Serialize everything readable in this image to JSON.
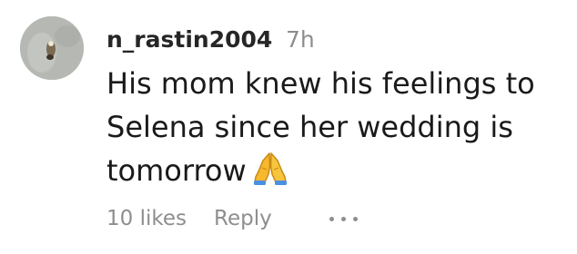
{
  "comment": {
    "username": "n_rastin2004",
    "time": "7h",
    "text_lines": [
      "His mom knew his feelings to",
      "Selena since her wedding is",
      "tomorrow"
    ],
    "emoji": "🙏",
    "emoji_icon": "folded-hands-icon",
    "likes": "10 likes",
    "reply_label": "Reply",
    "more_icon": "ellipsis-icon"
  }
}
